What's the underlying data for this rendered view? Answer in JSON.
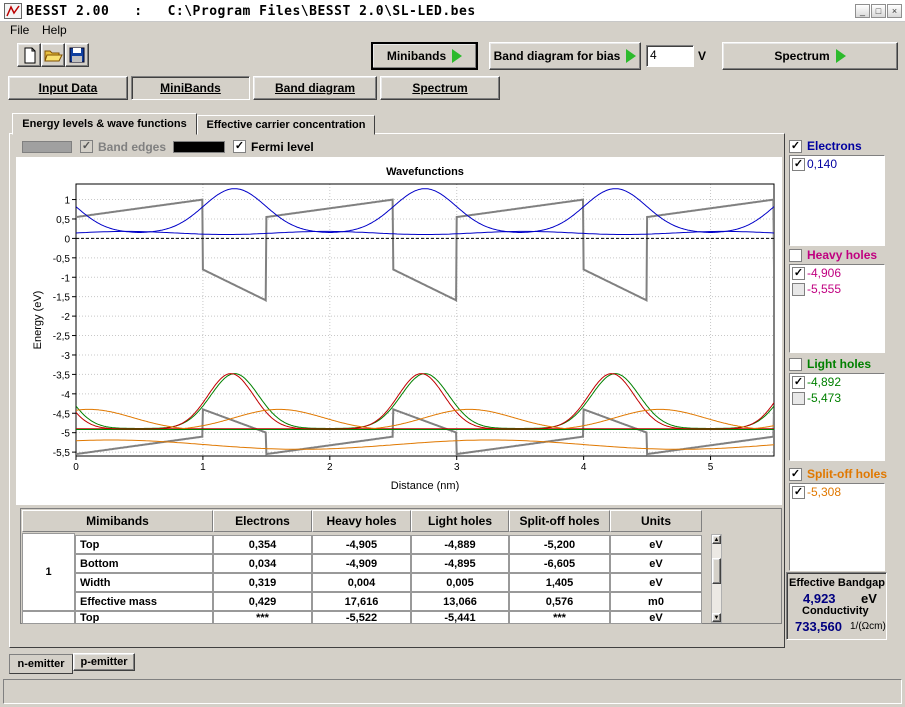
{
  "window": {
    "app": "BESST 2.00",
    "sep": ":",
    "path": "C:\\Program Files\\BESST 2.0\\SL-LED.bes",
    "min": "_",
    "max": "□",
    "close": "×"
  },
  "menu": [
    "File",
    "Help"
  ],
  "toolbar": {
    "minibands": "Minibands",
    "band_bias": "Band diagram for bias",
    "bias_value": "4",
    "bias_unit": "V",
    "spectrum": "Spectrum"
  },
  "tabs": [
    "Input Data",
    "MiniBands",
    "Band diagram",
    "Spectrum"
  ],
  "subtabs": [
    "Energy levels & wave functions",
    "Effective carrier concentration"
  ],
  "legend": {
    "band_edges": "Band edges",
    "fermi": "Fermi level"
  },
  "chart_data": {
    "type": "line",
    "title": "Wavefunctions",
    "xlabel": "Distance (nm)",
    "ylabel": "Energy (eV)",
    "xlim": [
      0,
      5.5
    ],
    "ylim": [
      -5.6,
      1.4
    ],
    "xticks": [
      "0",
      "1",
      "2",
      "3",
      "4",
      "5"
    ],
    "yticks": [
      "1",
      "0,5",
      "0",
      "-0,5",
      "-1",
      "-1,5",
      "-2",
      "-2,5",
      "-3",
      "-3,5",
      "-4",
      "-4,5",
      "-5",
      "-5,5"
    ],
    "period": 1.5,
    "colors": {
      "band": "#808080",
      "electron": "#0000c8",
      "heavy": "#c00000",
      "light": "#008000",
      "split": "#e07800",
      "fermi": "#000000"
    },
    "series": [
      {
        "name": "Electrons",
        "level": 0.14,
        "miniband_top": 0.354,
        "miniband_bottom": 0.034,
        "peak": 1.28
      },
      {
        "name": "Heavy holes",
        "level": -4.906
      },
      {
        "name": "Light holes",
        "level": -4.892,
        "peak": -3.48
      },
      {
        "name": "Split-off holes",
        "level": -5.308,
        "peak": -4.4
      },
      {
        "name": "Fermi level",
        "level": 0.0
      }
    ]
  },
  "groups": {
    "electrons": {
      "title": "Electrons",
      "items": [
        {
          "value": "0,140",
          "checked": true
        }
      ]
    },
    "heavy": {
      "title": "Heavy holes",
      "items": [
        {
          "value": "-4,906",
          "checked": true
        },
        {
          "value": "-5,555",
          "checked": false
        }
      ]
    },
    "light": {
      "title": "Light holes",
      "items": [
        {
          "value": "-4,892",
          "checked": true
        },
        {
          "value": "-5,473",
          "checked": false
        }
      ]
    },
    "split": {
      "title": "Split-off holes",
      "items": [
        {
          "value": "-5,308",
          "checked": true
        }
      ]
    }
  },
  "bandgap": {
    "title": "Effective Bandgap",
    "value": "4,923",
    "unit": "eV",
    "cond_title": "Conductivity",
    "cond_value": "733,560",
    "cond_unit": "1/(Ωcm)"
  },
  "table": {
    "headers": [
      "Mimibands",
      "Electrons",
      "Heavy holes",
      "Light holes",
      "Split-off holes",
      "Units"
    ],
    "band_label": "1",
    "rows": [
      {
        "name": "Top",
        "values": [
          "0,354",
          "-4,905",
          "-4,889",
          "-5,200"
        ],
        "unit": "eV"
      },
      {
        "name": "Bottom",
        "values": [
          "0,034",
          "-4,909",
          "-4,895",
          "-6,605"
        ],
        "unit": "eV"
      },
      {
        "name": "Width",
        "values": [
          "0,319",
          "0,004",
          "0,005",
          "1,405"
        ],
        "unit": "eV"
      },
      {
        "name": "Effective mass",
        "values": [
          "0,429",
          "17,616",
          "13,066",
          "0,576"
        ],
        "unit": "m0"
      },
      {
        "name": "Top",
        "values": [
          "***",
          "-5,522",
          "-5,441",
          "***"
        ],
        "unit": "eV"
      }
    ]
  },
  "bottom_tabs": [
    "n-emitter",
    "p-emitter"
  ]
}
